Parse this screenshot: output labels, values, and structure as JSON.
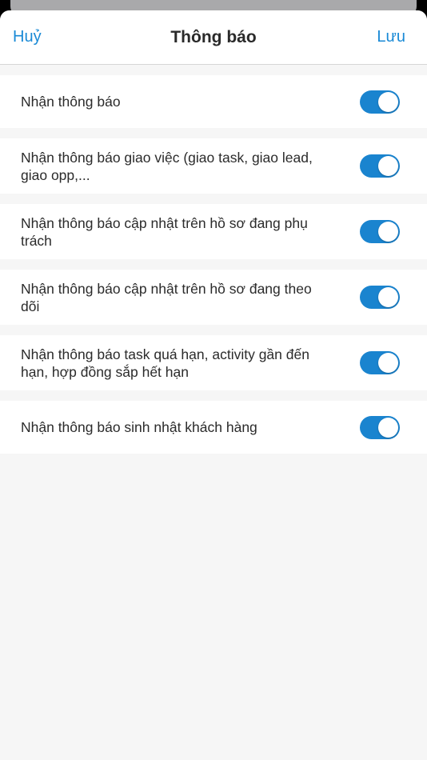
{
  "header": {
    "cancel_label": "Huỷ",
    "title": "Thông báo",
    "save_label": "Lưu"
  },
  "settings": [
    {
      "label": "Nhận thông báo",
      "enabled": true
    },
    {
      "label": "Nhận thông báo giao việc (giao task, giao lead, giao opp,...",
      "enabled": true
    },
    {
      "label": "Nhận thông báo cập nhật trên hồ sơ đang phụ trách",
      "enabled": true
    },
    {
      "label": "Nhận thông báo cập nhật trên hồ sơ đang theo dõi",
      "enabled": true
    },
    {
      "label": "Nhận thông báo task quá hạn, activity gần đến hạn, hợp đồng sắp hết hạn",
      "enabled": true
    },
    {
      "label": "Nhận thông báo sinh nhật khách hàng",
      "enabled": true
    }
  ],
  "colors": {
    "accent": "#1a8ad6",
    "toggle_on": "#1a84cf",
    "background": "#f6f6f6"
  }
}
